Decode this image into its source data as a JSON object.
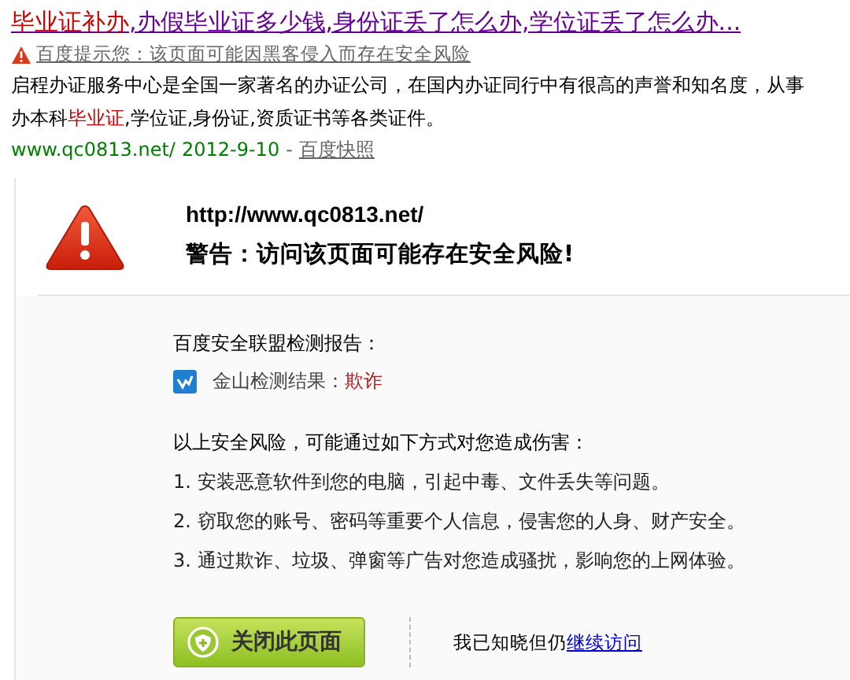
{
  "result": {
    "title": [
      {
        "text": "毕业证补办",
        "highlight": true
      },
      {
        "text": ",办假毕业证多少钱,身份证丢了怎么办,学位证丢了怎么办...",
        "highlight": false
      }
    ],
    "hint": "百度提示您：该页面可能因黑客侵入而存在安全风险",
    "snippet": [
      {
        "text": "启程办证服务中心是全国一家著名的办证公司，在国内办证同行中有很高的声誉和知名度，从事办本科",
        "highlight": false
      },
      {
        "text": "毕业证",
        "highlight": true
      },
      {
        "text": ",学位证,身份证,资质证书等各类证件。",
        "highlight": false
      }
    ],
    "url": "www.qc0813.net/",
    "date": "2012-9-10",
    "separator": "-",
    "cache_link": "百度快照"
  },
  "warning": {
    "url": "http://www.qc0813.net/",
    "heading": "警告：访问该页面可能存在安全风险!",
    "report_title": "百度安全联盟检测报告：",
    "scan_label": "金山检测结果：",
    "scan_result": "欺诈",
    "risk_intro": "以上安全风险，可能通过如下方式对您造成伤害：",
    "risks": [
      "1. 安装恶意软件到您的电脑，引起中毒、文件丢失等问题。",
      "2. 窃取您的账号、密码等重要个人信息，侵害您的人身、财产安全。",
      "3. 通过欺诈、垃圾、弹窗等广告对您造成骚扰，影响您的上网体验。"
    ],
    "close_button": "关闭此页面",
    "continue_text": "我已知晓但仍",
    "continue_link": "继续访问"
  }
}
